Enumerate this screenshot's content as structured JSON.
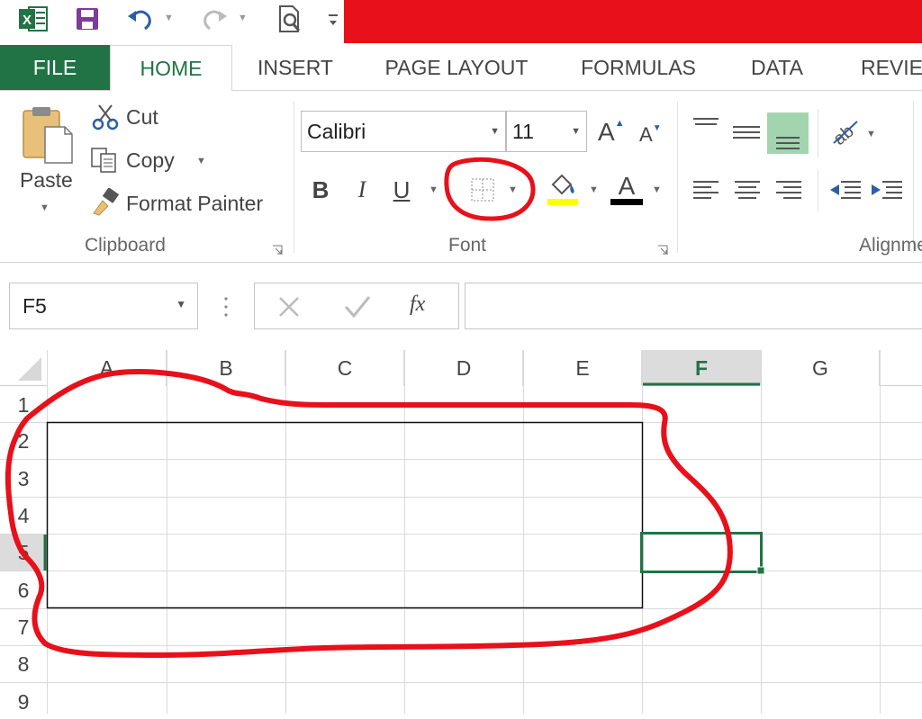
{
  "qat": {
    "icons": [
      "excel-logo",
      "save-icon",
      "undo-icon",
      "redo-icon",
      "print-preview-icon"
    ]
  },
  "tabs": [
    "FILE",
    "HOME",
    "INSERT",
    "PAGE LAYOUT",
    "FORMULAS",
    "DATA",
    "REVIEW"
  ],
  "clipboard": {
    "paste": "Paste",
    "cut": "Cut",
    "copy": "Copy",
    "format_painter": "Format Painter",
    "group_label": "Clipboard"
  },
  "font": {
    "name": "Calibri",
    "size": "11",
    "bold": "B",
    "italic": "I",
    "underline": "U",
    "grow": "A",
    "shrink": "A",
    "font_color_letter": "A",
    "group_label": "Font"
  },
  "alignment": {
    "group_label": "Alignment"
  },
  "name_box": "F5",
  "formula": {
    "fx": "fx",
    "value": ""
  },
  "grid": {
    "columns": [
      "A",
      "B",
      "C",
      "D",
      "E",
      "F",
      "G"
    ],
    "rows": [
      "1",
      "2",
      "3",
      "4",
      "5",
      "6",
      "7",
      "8",
      "9"
    ],
    "selected_cell": "F5"
  },
  "colors": {
    "accent": "#217346",
    "annotation": "#e8101a",
    "highlight_fill": "#ffff00"
  }
}
